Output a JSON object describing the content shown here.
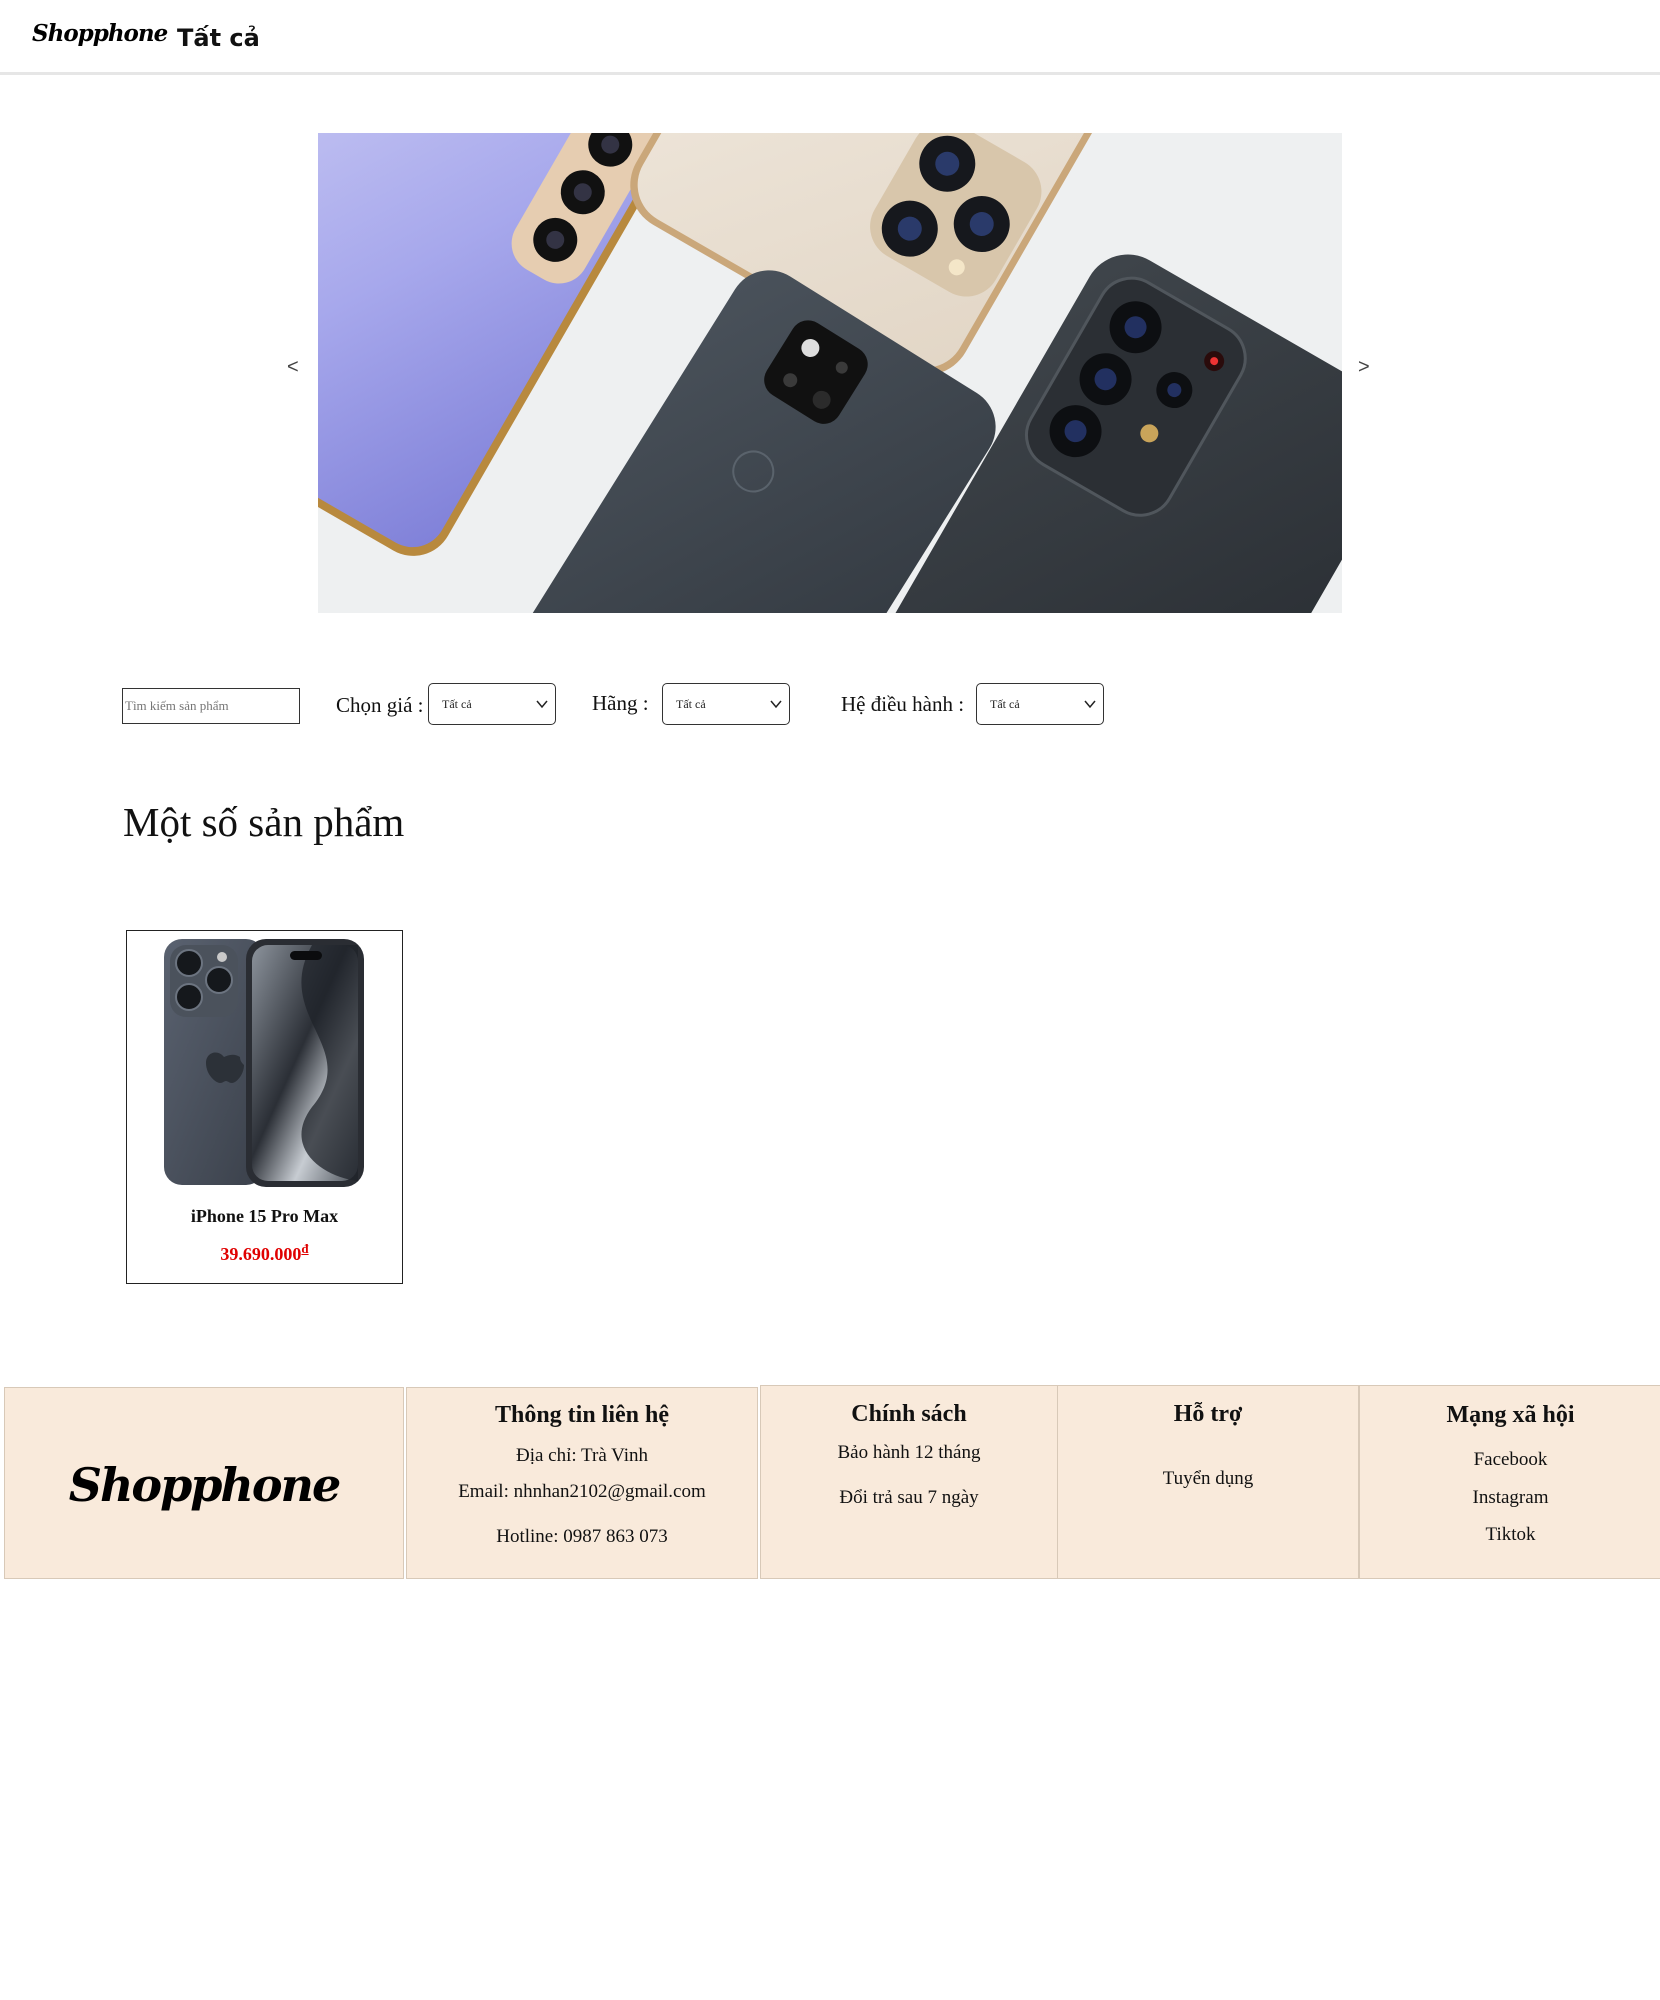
{
  "header": {
    "logo": "Shopphone",
    "nav_all": "Tất cả"
  },
  "banner": {
    "prev_label": "<",
    "next_label": ">",
    "image_icon": "smartphones-banner-image"
  },
  "filters": {
    "search_placeholder": "Tìm kiếm sản phẩm",
    "price_label": "Chọn giá :",
    "price_value": "Tất cả",
    "brand_label": "Hãng :",
    "brand_value": "Tất cả",
    "os_label": "Hệ điều hành :",
    "os_value": "Tất cả"
  },
  "products": {
    "section_title": "Một số sản phẩm",
    "items": [
      {
        "name": "iPhone 15 Pro Max",
        "price": "39.690.000",
        "currency": "đ",
        "image_icon": "iphone-product-image"
      }
    ]
  },
  "footer": {
    "logo": "Shopphone",
    "contact": {
      "title": "Thông tin liên hệ",
      "address": "Địa chỉ: Trà Vinh",
      "email": "Email: nhnhan2102@gmail.com",
      "hotline": "Hotline: 0987 863 073"
    },
    "policy": {
      "title": "Chính sách",
      "warranty": "Bảo hành 12 tháng",
      "return": "Đổi trả sau 7 ngày"
    },
    "support": {
      "title": "Hỗ trợ",
      "jobs": "Tuyển dụng"
    },
    "social": {
      "title": "Mạng xã hội",
      "facebook": "Facebook",
      "instagram": "Instagram",
      "tiktok": "Tiktok"
    }
  },
  "colors": {
    "price": "#e00000",
    "footer_bg": "#f9eadb",
    "header_border": "#e6e6e6"
  }
}
